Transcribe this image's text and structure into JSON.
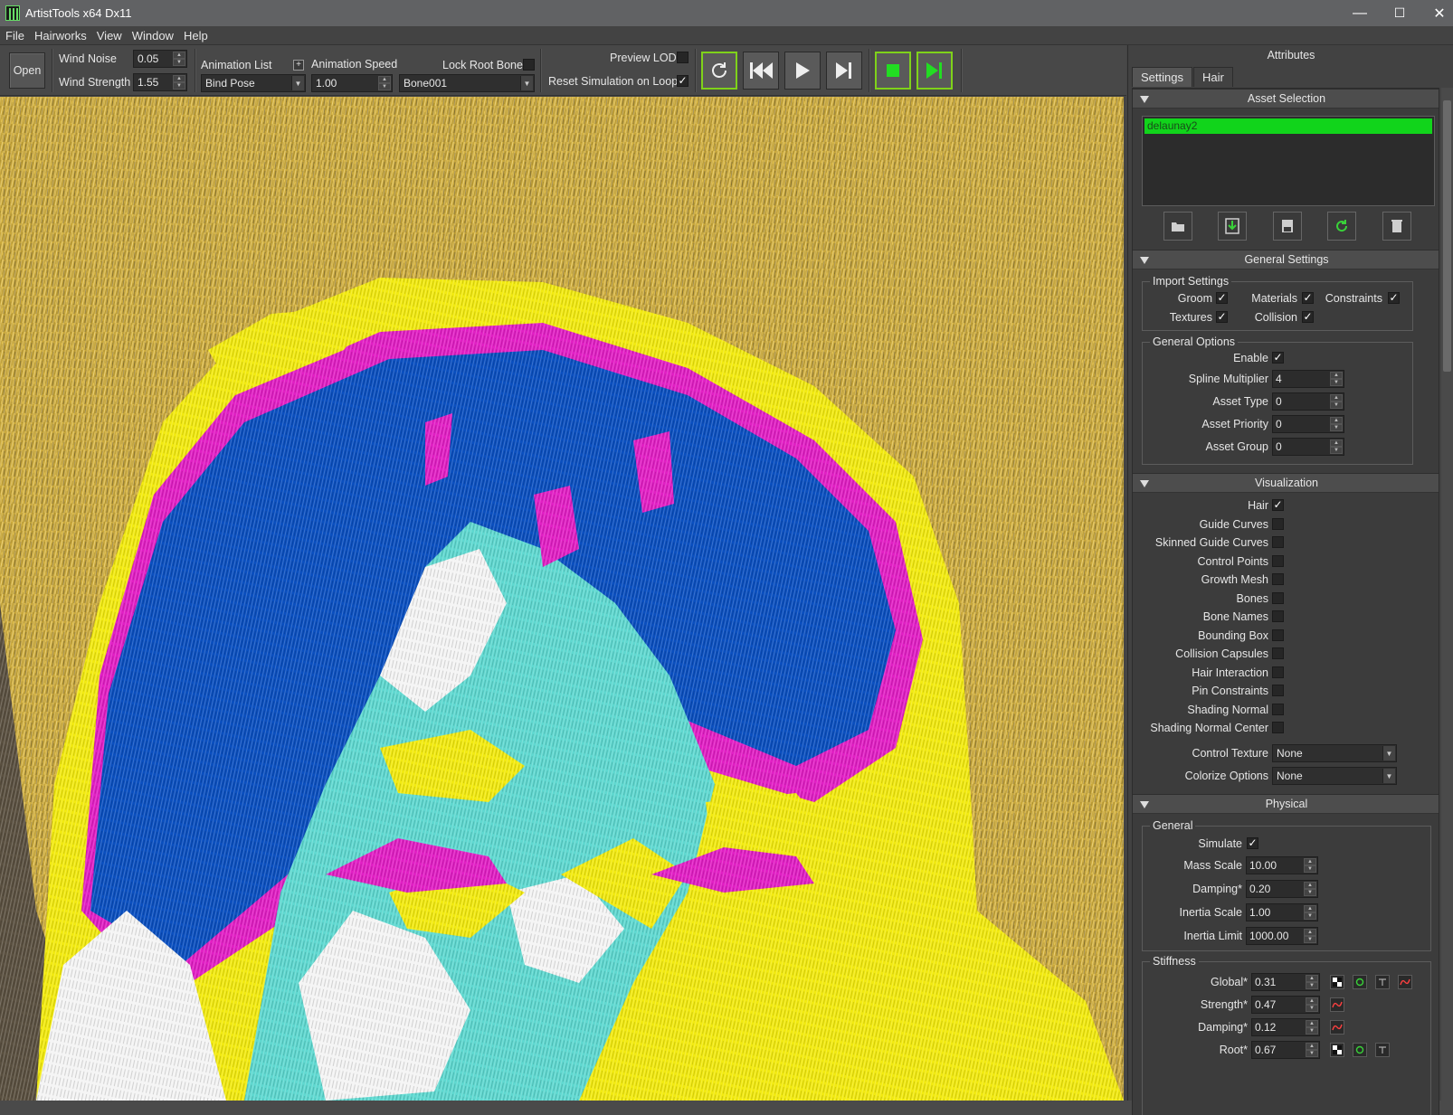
{
  "window": {
    "title": "ArtistTools x64 Dx11",
    "minimize": "—",
    "maximize": "☐",
    "close": "✕"
  },
  "menu": [
    "File",
    "Hairworks",
    "View",
    "Window",
    "Help"
  ],
  "toolbar": {
    "open_label": "Open",
    "wind_noise_label": "Wind Noise",
    "wind_noise_value": "0.05",
    "wind_strength_label": "Wind Strength",
    "wind_strength_value": "1.55",
    "animation_list_label": "Animation List",
    "animation_list_value": "Bind Pose",
    "plus_label": "+",
    "animation_speed_label": "Animation Speed",
    "animation_speed_value": "1.00",
    "lock_root_bone_label": "Lock Root Bone",
    "bone_value": "Bone001",
    "preview_lod_label": "Preview LOD",
    "reset_sim_label": "Reset Simulation on Loop",
    "reset_sim_checked": "✓"
  },
  "panel": {
    "title": "Attributes",
    "tabs": [
      "Settings",
      "Hair"
    ],
    "asset_selection": {
      "header": "Asset Selection",
      "items": [
        "delaunay2"
      ]
    },
    "general_settings": {
      "header": "General Settings",
      "import_settings_title": "Import Settings",
      "groom_label": "Groom",
      "materials_label": "Materials",
      "constraints_label": "Constraints",
      "textures_label": "Textures",
      "collision_label": "Collision",
      "check": "✓",
      "general_options_title": "General Options",
      "enable_label": "Enable",
      "spline_multiplier_label": "Spline Multiplier",
      "spline_multiplier_value": "4",
      "asset_type_label": "Asset Type",
      "asset_type_value": "0",
      "asset_priority_label": "Asset Priority",
      "asset_priority_value": "0",
      "asset_group_label": "Asset Group",
      "asset_group_value": "0"
    },
    "visualization": {
      "header": "Visualization",
      "items": [
        {
          "label": "Hair",
          "checked": "✓"
        },
        {
          "label": "Guide Curves",
          "checked": ""
        },
        {
          "label": "Skinned Guide Curves",
          "checked": ""
        },
        {
          "label": "Control Points",
          "checked": ""
        },
        {
          "label": "Growth Mesh",
          "checked": ""
        },
        {
          "label": "Bones",
          "checked": ""
        },
        {
          "label": "Bone Names",
          "checked": ""
        },
        {
          "label": "Bounding Box",
          "checked": ""
        },
        {
          "label": "Collision Capsules",
          "checked": ""
        },
        {
          "label": "Hair Interaction",
          "checked": ""
        },
        {
          "label": "Pin Constraints",
          "checked": ""
        },
        {
          "label": "Shading Normal",
          "checked": ""
        },
        {
          "label": "Shading Normal Center",
          "checked": ""
        }
      ],
      "control_texture_label": "Control Texture",
      "control_texture_value": "None",
      "colorize_options_label": "Colorize Options",
      "colorize_options_value": "None"
    },
    "physical": {
      "header": "Physical",
      "general_title": "General",
      "simulate_label": "Simulate",
      "simulate_checked": "✓",
      "mass_scale_label": "Mass Scale",
      "mass_scale_value": "10.00",
      "damping_label": "Damping*",
      "damping_value": "0.20",
      "inertia_scale_label": "Inertia Scale",
      "inertia_scale_value": "1.00",
      "inertia_limit_label": "Inertia Limit",
      "inertia_limit_value": "1000.00",
      "stiffness_title": "Stiffness",
      "global_label": "Global*",
      "global_value": "0.31",
      "strength_label": "Strength*",
      "strength_value": "0.47",
      "stiff_damping_label": "Damping*",
      "stiff_damping_value": "0.12",
      "root_label": "Root*",
      "root_value": "0.67"
    }
  },
  "colors": {
    "accent_green": "#7fd21a",
    "selection_green": "#11d41b",
    "viewport_gold": "#c8a53a",
    "hair_blue": "#0a4fbf",
    "hair_magenta": "#e11fc4",
    "hair_yellow": "#f2ea10",
    "hair_cyan": "#5fd8d0"
  }
}
